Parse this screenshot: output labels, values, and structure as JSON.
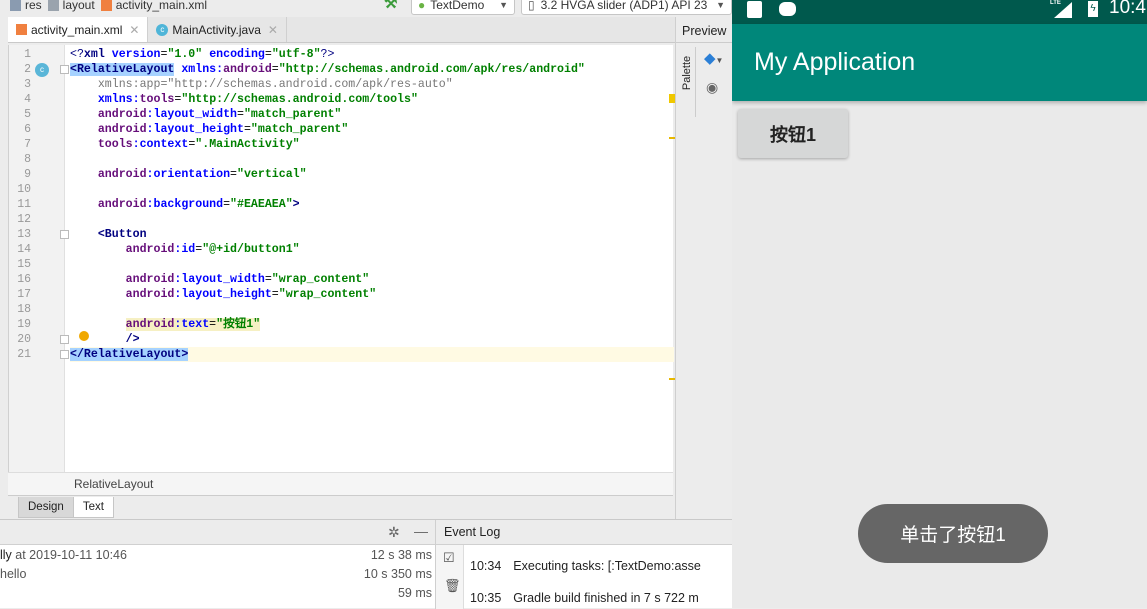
{
  "breadcrumb": [
    "res",
    "layout",
    "activity_main.xml"
  ],
  "toolbar": {
    "run_config": "TextDemo",
    "device": "3.2  HVGA slider (ADP1) API 23"
  },
  "editor_tabs": [
    {
      "label": "activity_main.xml",
      "active": true
    },
    {
      "label": "MainActivity.java",
      "active": false
    }
  ],
  "preview_label": "Preview",
  "palette_label": "Palette",
  "code": [
    [
      [
        "<?",
        "pi"
      ],
      [
        "xml ",
        "tag"
      ],
      [
        "version",
        "attr"
      ],
      [
        "=",
        "plain"
      ],
      [
        "\"1.0\"",
        "val"
      ],
      [
        " ",
        "plain"
      ],
      [
        "encoding",
        "attr"
      ],
      [
        "=",
        "plain"
      ],
      [
        "\"utf-8\"",
        "val"
      ],
      [
        "?>",
        "pi"
      ]
    ],
    [
      [
        "<RelativeLayout",
        "tag-sel"
      ],
      [
        " ",
        "plain"
      ],
      [
        "xmlns:",
        "attr"
      ],
      [
        "android",
        "ns"
      ],
      [
        "=",
        "plain"
      ],
      [
        "\"http://schemas.android.com/apk/res/android\"",
        "val"
      ]
    ],
    [
      [
        "    xmlns:app=\"http://schemas.android.com/apk/res-auto\"",
        "gray"
      ]
    ],
    [
      [
        "    ",
        "plain"
      ],
      [
        "xmlns:",
        "attr"
      ],
      [
        "tools",
        "ns"
      ],
      [
        "=",
        "plain"
      ],
      [
        "\"http://schemas.android.com/tools\"",
        "val"
      ]
    ],
    [
      [
        "    ",
        "plain"
      ],
      [
        "android",
        "ns"
      ],
      [
        ":layout_width",
        "attr"
      ],
      [
        "=",
        "plain"
      ],
      [
        "\"match_parent\"",
        "val"
      ]
    ],
    [
      [
        "    ",
        "plain"
      ],
      [
        "android",
        "ns"
      ],
      [
        ":layout_height",
        "attr"
      ],
      [
        "=",
        "plain"
      ],
      [
        "\"match_parent\"",
        "val"
      ]
    ],
    [
      [
        "    ",
        "plain"
      ],
      [
        "tools",
        "ns"
      ],
      [
        ":context",
        "attr"
      ],
      [
        "=",
        "plain"
      ],
      [
        "\".MainActivity\"",
        "val"
      ]
    ],
    [],
    [
      [
        "    ",
        "plain"
      ],
      [
        "android",
        "ns"
      ],
      [
        ":orientation",
        "attr"
      ],
      [
        "=",
        "plain"
      ],
      [
        "\"vertical\"",
        "val"
      ]
    ],
    [],
    [
      [
        "    ",
        "plain"
      ],
      [
        "android",
        "ns"
      ],
      [
        ":background",
        "attr"
      ],
      [
        "=",
        "plain"
      ],
      [
        "\"#EAEAEA\"",
        "val"
      ],
      [
        ">",
        "tag"
      ]
    ],
    [],
    [
      [
        "    ",
        "plain"
      ],
      [
        "<Button",
        "tag"
      ]
    ],
    [
      [
        "        ",
        "plain"
      ],
      [
        "android",
        "ns"
      ],
      [
        ":id",
        "attr"
      ],
      [
        "=",
        "plain"
      ],
      [
        "\"@+id/button1\"",
        "val"
      ]
    ],
    [],
    [
      [
        "        ",
        "plain"
      ],
      [
        "android",
        "ns"
      ],
      [
        ":layout_width",
        "attr"
      ],
      [
        "=",
        "plain"
      ],
      [
        "\"wrap_content\"",
        "val"
      ]
    ],
    [
      [
        "        ",
        "plain"
      ],
      [
        "android",
        "ns"
      ],
      [
        ":layout_height",
        "attr"
      ],
      [
        "=",
        "plain"
      ],
      [
        "\"wrap_content\"",
        "val"
      ]
    ],
    [],
    [
      [
        "        ",
        "plain"
      ],
      [
        "android",
        "ns-warn"
      ],
      [
        ":text",
        "attr-warn"
      ],
      [
        "=",
        "plain-warn"
      ],
      [
        "\"按钮1\"",
        "val-warn"
      ]
    ],
    [
      [
        "        ",
        "plain"
      ],
      [
        "/>",
        "tag"
      ]
    ],
    [
      [
        "</RelativeLayout>",
        "tag-sel"
      ]
    ]
  ],
  "current_line": 21,
  "editor_breadcrumb": "RelativeLayout",
  "view_tabs": [
    {
      "label": "Design",
      "active": false
    },
    {
      "label": "Text",
      "active": true
    }
  ],
  "build": {
    "rows": [
      {
        "label_strong": "lly",
        "label": " at 2019-10-11 10:46",
        "time": "12 s 38 ms"
      },
      {
        "label_strong": "",
        "label": "hello",
        "time": "10 s 350 ms"
      },
      {
        "label_strong": "",
        "label": "",
        "time": "59 ms"
      }
    ]
  },
  "event_log": {
    "title": "Event Log",
    "entries": [
      {
        "time": "10:34",
        "text": "Executing tasks: [:TextDemo:asse"
      },
      {
        "time": "10:35",
        "text": "Gradle build finished in 7 s 722 m"
      }
    ]
  },
  "emulator": {
    "clock": "10:4",
    "network": "LTE",
    "app_title": "My Application",
    "button_label": "按钮1",
    "toast": "单击了按钮1",
    "colors": {
      "status_bar": "#00594d",
      "app_bar": "#00877a",
      "background": "#eaeaea"
    }
  }
}
